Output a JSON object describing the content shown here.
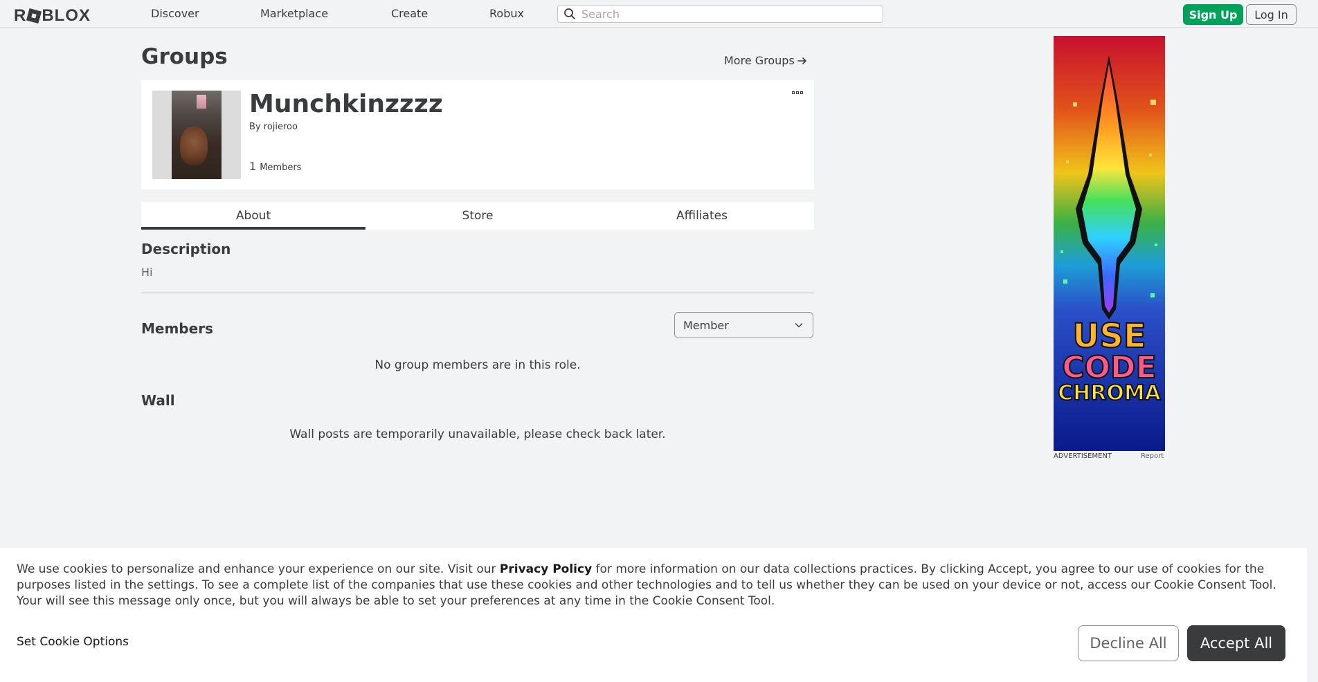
{
  "nav": {
    "logo": "ROBLOX",
    "links": [
      "Discover",
      "Marketplace",
      "Create",
      "Robux"
    ],
    "search_placeholder": "Search",
    "signup_label": "Sign Up",
    "login_label": "Log In"
  },
  "page": {
    "title": "Groups",
    "more_groups": "More Groups"
  },
  "group": {
    "name": "Munchkinzzzz",
    "by_label": "By",
    "owner": "rojieroo",
    "member_count": "1",
    "member_label": "Members"
  },
  "tabs": [
    {
      "label": "About",
      "active": true
    },
    {
      "label": "Store",
      "active": false
    },
    {
      "label": "Affiliates",
      "active": false
    }
  ],
  "about": {
    "description_title": "Description",
    "description_text": "Hi",
    "members_title": "Members",
    "role_selected": "Member",
    "members_empty": "No group members are in this role.",
    "wall_title": "Wall",
    "wall_empty": "Wall posts are temporarily unavailable, please check back later."
  },
  "ad": {
    "line1": "USE",
    "line2": "CODE",
    "line3": "CHROMA",
    "label": "ADVERTISEMENT",
    "report": "Report"
  },
  "cookie": {
    "text_before": "We use cookies to personalize and enhance your experience on our site. Visit our ",
    "privacy_link": "Privacy Policy",
    "text_after": " for more information on our data collections practices. By clicking Accept, you agree to our use of cookies for the purposes listed in the settings. To see a complete list of the companies that use these cookies and other technologies and to tell us whether they can be used on your device or not, access our Cookie Consent Tool. Your will see this message only once, but you will always be able to set your preferences at any time in the Cookie Consent Tool.",
    "options_label": "Set Cookie Options",
    "decline_label": "Decline All",
    "accept_label": "Accept All"
  },
  "colors": {
    "accent_green": "#00a25b",
    "text_dark": "#393b3d",
    "background": "#f2f3f5"
  }
}
